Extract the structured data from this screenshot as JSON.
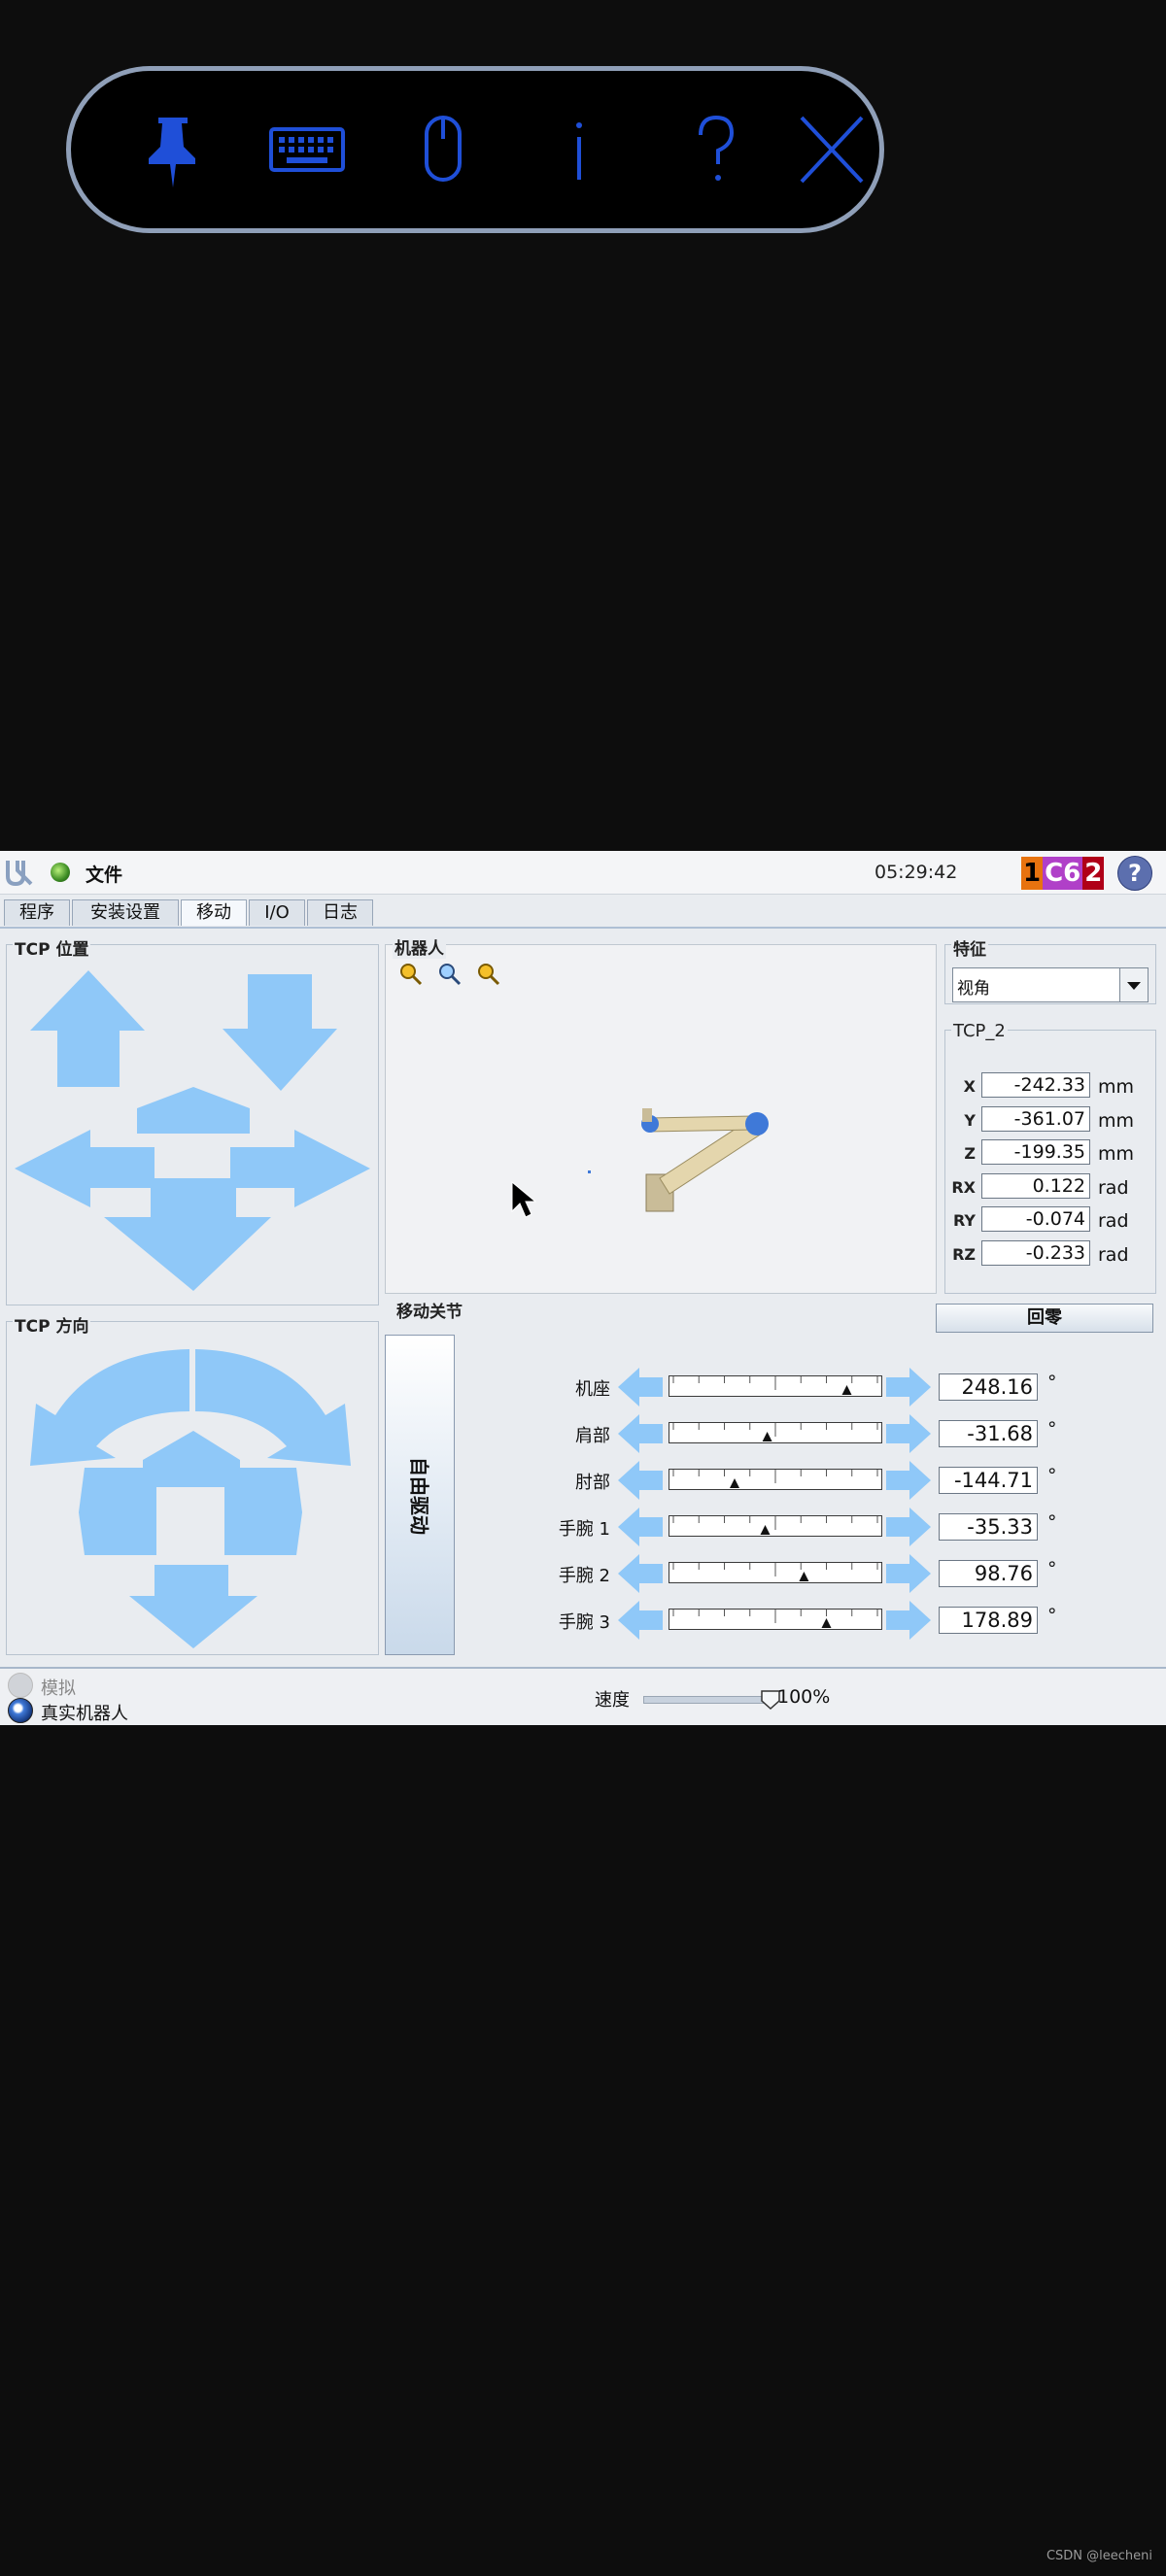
{
  "toolbar": {
    "buttons": [
      {
        "icon": "pin-icon"
      },
      {
        "icon": "keyboard-icon"
      },
      {
        "icon": "mouse-icon"
      },
      {
        "icon": "info-icon"
      },
      {
        "icon": "question-icon"
      },
      {
        "icon": "close-icon"
      }
    ],
    "icon_color": "#1f4fd8"
  },
  "header": {
    "file_label": "文件",
    "time": "05:29:42",
    "badge": [
      "1",
      "C6",
      "2"
    ],
    "help": "?"
  },
  "tabs": [
    {
      "label": "程序",
      "active": false
    },
    {
      "label": "安装设置",
      "active": false
    },
    {
      "label": "移动",
      "active": true
    },
    {
      "label": "I/O",
      "active": false
    },
    {
      "label": "日志",
      "active": false
    }
  ],
  "tcp_position": {
    "title": "TCP 位置"
  },
  "tcp_orientation": {
    "title": "TCP 方向"
  },
  "robot_view": {
    "title": "机器人"
  },
  "feature": {
    "title": "特征",
    "selected": "视角"
  },
  "tcp": {
    "title": "TCP_2",
    "rows": [
      {
        "label": "X",
        "value": "-242.33",
        "unit": "mm"
      },
      {
        "label": "Y",
        "value": "-361.07",
        "unit": "mm"
      },
      {
        "label": "Z",
        "value": "-199.35",
        "unit": "mm"
      },
      {
        "label": "RX",
        "value": "0.122",
        "unit": "rad"
      },
      {
        "label": "RY",
        "value": "-0.074",
        "unit": "rad"
      },
      {
        "label": "RZ",
        "value": "-0.233",
        "unit": "rad"
      }
    ]
  },
  "move_joints": {
    "title": "移动关节",
    "home_label": "回零",
    "freedrive_label": "自由驱动",
    "unit": "°",
    "joints": [
      {
        "label": "机座",
        "value": "248.16",
        "level": 0.85
      },
      {
        "label": "肩部",
        "value": "-31.68",
        "level": 0.46
      },
      {
        "label": "肘部",
        "value": "-144.71",
        "level": 0.3
      },
      {
        "label": "手腕 1",
        "value": "-35.33",
        "level": 0.45
      },
      {
        "label": "手腕 2",
        "value": "98.76",
        "level": 0.64
      },
      {
        "label": "手腕 3",
        "value": "178.89",
        "level": 0.75
      }
    ]
  },
  "bottom": {
    "simulate_label": "模拟",
    "real_robot_label": "真实机器人",
    "speed_label": "速度",
    "speed_value": "100%",
    "speed_level": 1.0
  },
  "watermark": "CSDN @leecheni"
}
